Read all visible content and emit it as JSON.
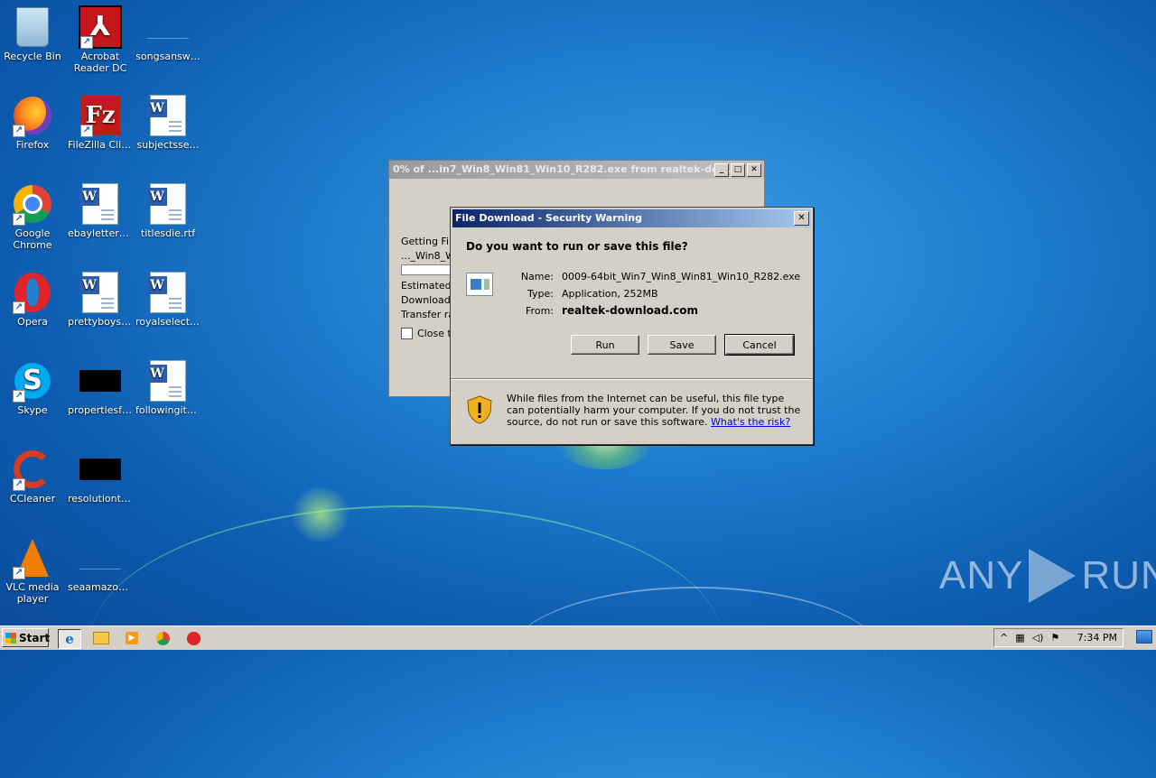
{
  "desktop": {
    "icons": [
      {
        "label": "Recycle Bin",
        "icon": "recycle-bin-icon"
      },
      {
        "label": "Acrobat Reader DC",
        "icon": "acrobat-icon"
      },
      {
        "label": "songsansw…",
        "icon": "blank-file-icon"
      },
      {
        "label": "Firefox",
        "icon": "firefox-icon"
      },
      {
        "label": "FileZilla Client",
        "icon": "filezilla-icon"
      },
      {
        "label": "subjectsse…",
        "icon": "word-document-icon"
      },
      {
        "label": "Google Chrome",
        "icon": "chrome-icon"
      },
      {
        "label": "ebayletters.rtf",
        "icon": "word-document-icon"
      },
      {
        "label": "titlesdie.rtf",
        "icon": "word-document-icon"
      },
      {
        "label": "Opera",
        "icon": "opera-icon"
      },
      {
        "label": "prettyboys.rtf",
        "icon": "word-document-icon"
      },
      {
        "label": "royalselecti…",
        "icon": "word-document-icon"
      },
      {
        "label": "Skype",
        "icon": "skype-icon"
      },
      {
        "label": "propertiesfo…",
        "icon": "black-thumbnail-icon"
      },
      {
        "label": "followingital…",
        "icon": "word-document-icon"
      },
      {
        "label": "CCleaner",
        "icon": "ccleaner-icon"
      },
      {
        "label": "resolutiontr…",
        "icon": "black-thumbnail-icon"
      },
      {
        "label": "VLC media player",
        "icon": "vlc-icon"
      },
      {
        "label": "seaamazon…",
        "icon": "blank-file-icon"
      }
    ]
  },
  "progress_window": {
    "title": "0% of ...in7_Win8_Win81_Win10_R282.exe from realtek-dow...",
    "getting_file": "Getting File",
    "filename_partial": "..._Win8_W",
    "estimated": "Estimated ti",
    "download_to": "Download t",
    "transfer_rate": "Transfer rat",
    "close_checkbox": "Close th"
  },
  "dialog": {
    "title": "File Download - Security Warning",
    "question": "Do you want to run or save this file?",
    "name_label": "Name:",
    "name_value": "0009-64bit_Win7_Win8_Win81_Win10_R282.exe",
    "type_label": "Type:",
    "type_value": "Application, 252MB",
    "from_label": "From:",
    "from_value": "realtek-download.com",
    "run": "Run",
    "save": "Save",
    "cancel": "Cancel",
    "warning": "While files from the Internet can be useful, this file type can potentially harm your computer. If you do not trust the source, do not run or save this software.",
    "risk_link": "What's the risk?"
  },
  "watermark": {
    "left": "ANY",
    "right": "RUN"
  },
  "taskbar": {
    "start": "Start",
    "clock": "7:34 PM"
  }
}
